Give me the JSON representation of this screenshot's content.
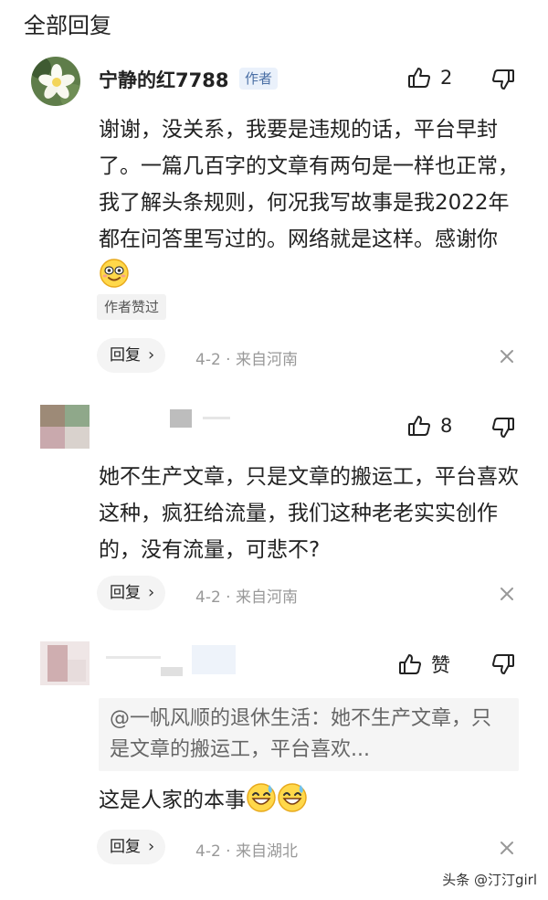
{
  "header": {
    "title": "全部回复"
  },
  "comments": [
    {
      "username": "宁静的红7788",
      "badge": "作者",
      "likes": "2",
      "text": "谢谢，没关系，我要是违规的话，平台早封了。一篇几百字的文章有两句是一样也正常，我了解头条规则，何况我写故事是我2022年都在问答里写过的。网络就是这样。感谢你",
      "liked_tag": "作者赞过",
      "reply_label": "回复",
      "meta": "4-2 · 来自河南"
    },
    {
      "username": "",
      "likes": "8",
      "text": "她不生产文章，只是文章的搬运工，平台喜欢这种，疯狂给流量，我们这种老老实实创作的，没有流量，可悲不?",
      "reply_label": "回复",
      "meta": "4-2 · 来自河南"
    },
    {
      "username": "",
      "likes": "赞",
      "quote": "@一帆风顺的退休生活：她不生产文章，只是文章的搬运工，平台喜欢...",
      "text": "这是人家的本事",
      "reply_label": "回复",
      "meta": "4-2 · 来自湖北"
    }
  ],
  "watermark": "头条 @汀汀girl",
  "icons": [
    "thumb-up-icon",
    "thumb-down-icon",
    "close-icon",
    "chevron-right-icon",
    "smile-emoji-icon",
    "grin-sweat-emoji-icon"
  ],
  "colors": {
    "badge_bg": "#eaf1fb",
    "badge_text": "#4a6fa5",
    "meta_text": "#999999",
    "reply_bg": "#f4f4f4"
  }
}
